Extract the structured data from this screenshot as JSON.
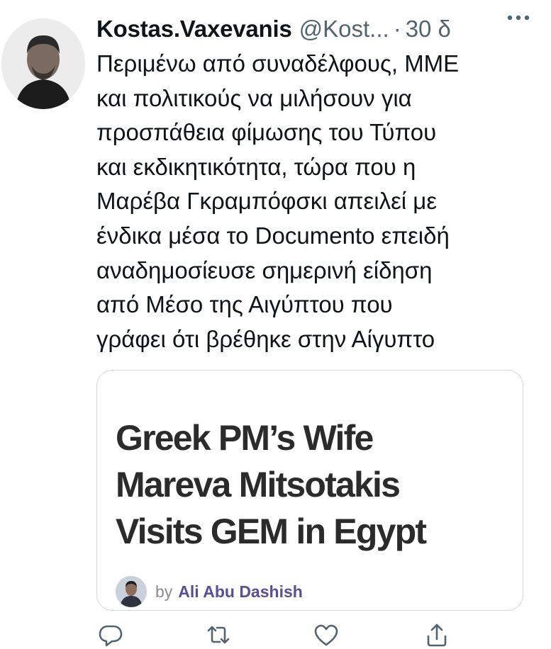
{
  "author": {
    "display_name": "Kostas.Vaxevanis",
    "handle": "@Kost...",
    "separator": "·",
    "timestamp": "30 δ",
    "avatar_icon": "profile-photo"
  },
  "tweet": {
    "text": "Περιμένω από συναδέλφους, ΜΜΕ\nκαι πολιτικούς να μιλήσουν για\nπροσπάθεια φίμωσης του Τύπου\nκαι εκδικητικότητα, τώρα που η\nΜαρέβα Γκραμπόφσκι απειλεί με\nένδικα μέσα το Documento επειδή\nαναδημοσίευσε σημερινή είδηση\nαπό Μέσο της Αιγύπτου που\nγράφει ότι βρέθηκε στην Αίγυπτο"
  },
  "card": {
    "headline": "Greek PM’s Wife\nMareva Mitsotakis\nVisits GEM in Egypt",
    "by_label": "by",
    "author_name": "Ali Abu Dashish"
  },
  "actions": {
    "icons": [
      "reply-icon",
      "retweet-icon",
      "like-icon",
      "share-icon"
    ]
  },
  "colors": {
    "secondary_text": "#536471",
    "card_border": "#cfd9de",
    "byline_author": "#5b4d9a"
  }
}
